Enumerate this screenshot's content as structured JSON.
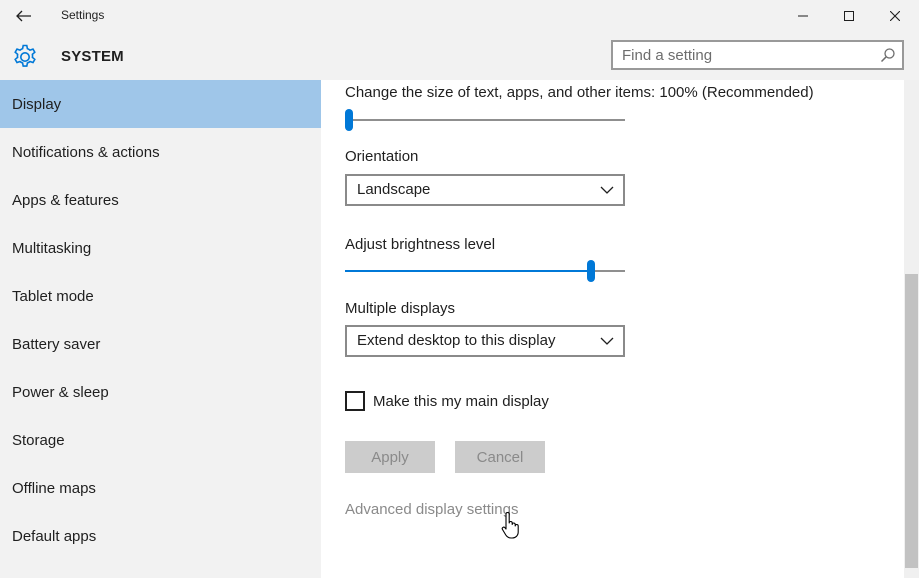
{
  "window": {
    "title": "Settings"
  },
  "header": {
    "section_title": "SYSTEM",
    "search_placeholder": "Find a setting"
  },
  "sidebar": {
    "items": [
      {
        "label": "Display",
        "selected": true
      },
      {
        "label": "Notifications & actions"
      },
      {
        "label": "Apps & features"
      },
      {
        "label": "Multitasking"
      },
      {
        "label": "Tablet mode"
      },
      {
        "label": "Battery saver"
      },
      {
        "label": "Power & sleep"
      },
      {
        "label": "Storage"
      },
      {
        "label": "Offline maps"
      },
      {
        "label": "Default apps"
      }
    ]
  },
  "content": {
    "scale_label": "Change the size of text, apps, and other items: 100% (Recommended)",
    "scale_slider_value": 0,
    "orientation_label": "Orientation",
    "orientation_value": "Landscape",
    "brightness_label": "Adjust brightness level",
    "brightness_value": 0.89,
    "multiple_displays_label": "Multiple displays",
    "multiple_displays_value": "Extend desktop to this display",
    "main_display_label": "Make this my main display",
    "main_display_checked": false,
    "apply_label": "Apply",
    "cancel_label": "Cancel",
    "advanced_link": "Advanced display settings"
  },
  "colors": {
    "accent": "#0078d7",
    "selected_nav": "#9fc6e9",
    "chrome_bg": "#f2f2f2",
    "disabled_button": "#cccccc",
    "disabled_text": "#8a8a8a"
  },
  "icons": {
    "back": "back-arrow-icon",
    "system": "gear-icon",
    "search": "search-icon",
    "dropdown": "chevron-down-icon"
  }
}
